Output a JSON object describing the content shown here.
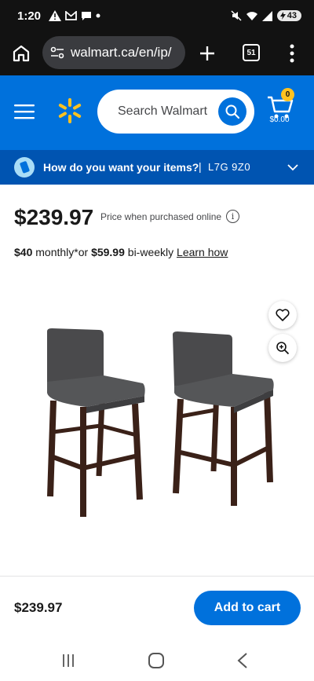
{
  "status_bar": {
    "time": "1:20",
    "battery": "43"
  },
  "browser": {
    "url": "walmart.ca/en/ip/",
    "tab_count": "51"
  },
  "header": {
    "search_placeholder": "Search Walmart",
    "cart_count": "0",
    "cart_total": "$0.00",
    "brand_color": "#0071dc",
    "spark_color": "#ffc220"
  },
  "delivery": {
    "question": "How do you want your items?",
    "separator": "|",
    "postal_code": "L7G 9Z0"
  },
  "product": {
    "price": "$239.97",
    "price_note": "Price when purchased online",
    "finance": {
      "monthly_amount": "$40",
      "monthly_label": " monthly*or ",
      "biweekly_amount": "$59.99",
      "biweekly_label": " bi-weekly ",
      "learn_link": "Learn how"
    }
  },
  "sticky_footer": {
    "price": "$239.97",
    "add_to_cart_label": "Add to cart"
  }
}
